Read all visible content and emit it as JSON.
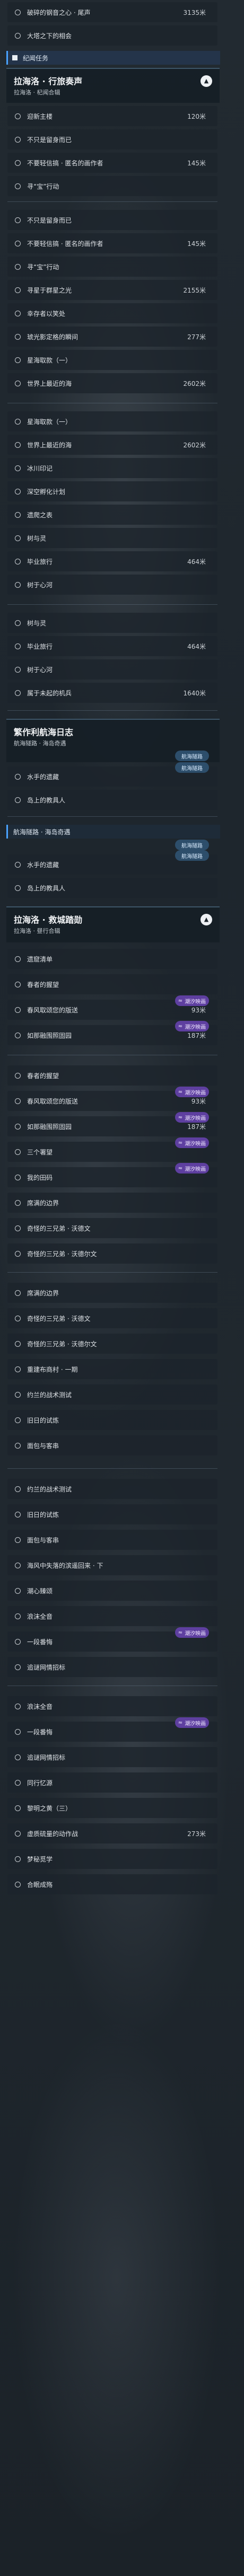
{
  "top_items": [
    {
      "label": "破碎的钢音之心 · 尾声",
      "dist": "3135米"
    },
    {
      "label": "大塔之下的相会",
      "dist": ""
    }
  ],
  "section_label": "纪闻任务",
  "quest1": {
    "title": "拉海洛 · 行旅奏声",
    "sub": "拉海洛 · 杞闻合辑",
    "toggle": "▲"
  },
  "quest1_items": [
    {
      "label": "迎新主楼",
      "dist": "120米"
    },
    {
      "label": "不只是留身而已",
      "dist": ""
    },
    {
      "label": "不要轻信搞 · 匿名的画作者",
      "dist": "145米"
    },
    {
      "label": "寻“宝”行动",
      "dist": ""
    }
  ],
  "list2": [
    {
      "label": "不只是留身而已",
      "dist": ""
    },
    {
      "label": "不要轻信搞 · 匿名的画作者",
      "dist": "145米"
    },
    {
      "label": "寻“宝”行动",
      "dist": ""
    },
    {
      "label": "寻星于群星之光",
      "dist": "2155米"
    },
    {
      "label": "幸存者以笑处",
      "dist": ""
    },
    {
      "label": "琥光影定格的瞬间",
      "dist": "277米"
    },
    {
      "label": "星海取款（一）",
      "dist": ""
    },
    {
      "label": "世界上最近的海",
      "dist": "2602米"
    }
  ],
  "list3": [
    {
      "label": "星海取款（一）",
      "dist": ""
    },
    {
      "label": "世界上最近的海",
      "dist": "2602米"
    },
    {
      "label": "冰川印记",
      "dist": ""
    },
    {
      "label": "深空孵化计划",
      "dist": ""
    },
    {
      "label": "遗爬之表",
      "dist": ""
    },
    {
      "label": "树与灵",
      "dist": ""
    },
    {
      "label": "毕业旅行",
      "dist": "464米"
    },
    {
      "label": "树于心河",
      "dist": ""
    }
  ],
  "list4": [
    {
      "label": "树与灵",
      "dist": ""
    },
    {
      "label": "毕业旅行",
      "dist": "464米"
    },
    {
      "label": "树于心河",
      "dist": ""
    },
    {
      "label": "属于未起的机兵",
      "dist": "1640米"
    }
  ],
  "quest2": {
    "title": "繁作利航海日志",
    "sub": "航海隧路 · 海岛奇遇",
    "badge": "航海隧路"
  },
  "quest2_items": [
    {
      "label": "水手的遗藏",
      "dist": "",
      "badge": "航海隧路"
    },
    {
      "label": "岛上的教具人",
      "dist": ""
    }
  ],
  "quest2b_header": {
    "label": "航海隧路 · 海岛奇遇",
    "badge": "航海隧路"
  },
  "quest2b_items": [
    {
      "label": "水手的遗藏",
      "dist": "",
      "badge": "航海隧路"
    },
    {
      "label": "岛上的教具人",
      "dist": ""
    }
  ],
  "quest3": {
    "title": "拉海洛 · 救城踏勋",
    "sub": "拉海洛 · 昼行合辑",
    "toggle": "▲"
  },
  "quest3_items": [
    {
      "label": "遗窟清单",
      "dist": ""
    },
    {
      "label": "春者的握望",
      "dist": ""
    },
    {
      "label": "春风取颂您的版送",
      "dist": "93米",
      "badge": "潮汐映画"
    },
    {
      "label": "如那融围照固园",
      "dist": "187米",
      "badge": "潮汐映画"
    }
  ],
  "list5": [
    {
      "label": "春者的握望",
      "dist": ""
    },
    {
      "label": "春风取颂您的版送",
      "dist": "93米",
      "badge": "潮汐映画"
    },
    {
      "label": "如那融围照固园",
      "dist": "187米",
      "badge": "潮汐映画"
    },
    {
      "label": "三个署望",
      "dist": "",
      "badge": "潮汐映画"
    },
    {
      "label": "我的田码",
      "dist": "",
      "badge": "潮汐映画"
    },
    {
      "label": "席满的边界",
      "dist": ""
    },
    {
      "label": "奇怪的三兄弟 · 沃德文",
      "dist": ""
    },
    {
      "label": "奇怪的三兄弟 · 沃德尔文",
      "dist": ""
    }
  ],
  "list6": [
    {
      "label": "席满的边界",
      "dist": ""
    },
    {
      "label": "奇怪的三兄弟 · 沃德文",
      "dist": ""
    },
    {
      "label": "奇怪的三兄弟 · 沃德尔文",
      "dist": ""
    },
    {
      "label": "重建布商村 · 一期",
      "dist": ""
    },
    {
      "label": "约兰的战术测试",
      "dist": ""
    },
    {
      "label": "旧日的试炼",
      "dist": ""
    },
    {
      "label": "面包与客串",
      "dist": ""
    }
  ],
  "list7": [
    {
      "label": "约兰的战术测试",
      "dist": ""
    },
    {
      "label": "旧日的试炼",
      "dist": ""
    },
    {
      "label": "面包与客串",
      "dist": ""
    },
    {
      "label": "海风中失落的滨遥回来 · 下",
      "dist": ""
    },
    {
      "label": "潮心臻颂",
      "dist": ""
    },
    {
      "label": "浪沫全音",
      "dist": ""
    },
    {
      "label": "一段番悔",
      "dist": "",
      "badge": "潮汐映画"
    },
    {
      "label": "追谜网情招标",
      "dist": ""
    }
  ],
  "list8": [
    {
      "label": "浪沫全音",
      "dist": ""
    },
    {
      "label": "一段番悔",
      "dist": "",
      "badge": "潮汐映画"
    },
    {
      "label": "追谜网情招标",
      "dist": ""
    },
    {
      "label": "同行忆源",
      "dist": ""
    },
    {
      "label": "黎明之黄（三）",
      "dist": ""
    },
    {
      "label": "虚质硫量的动作战",
      "dist": "273米"
    },
    {
      "label": "梦秘觅学",
      "dist": ""
    },
    {
      "label": "合眠成殇",
      "dist": ""
    }
  ]
}
